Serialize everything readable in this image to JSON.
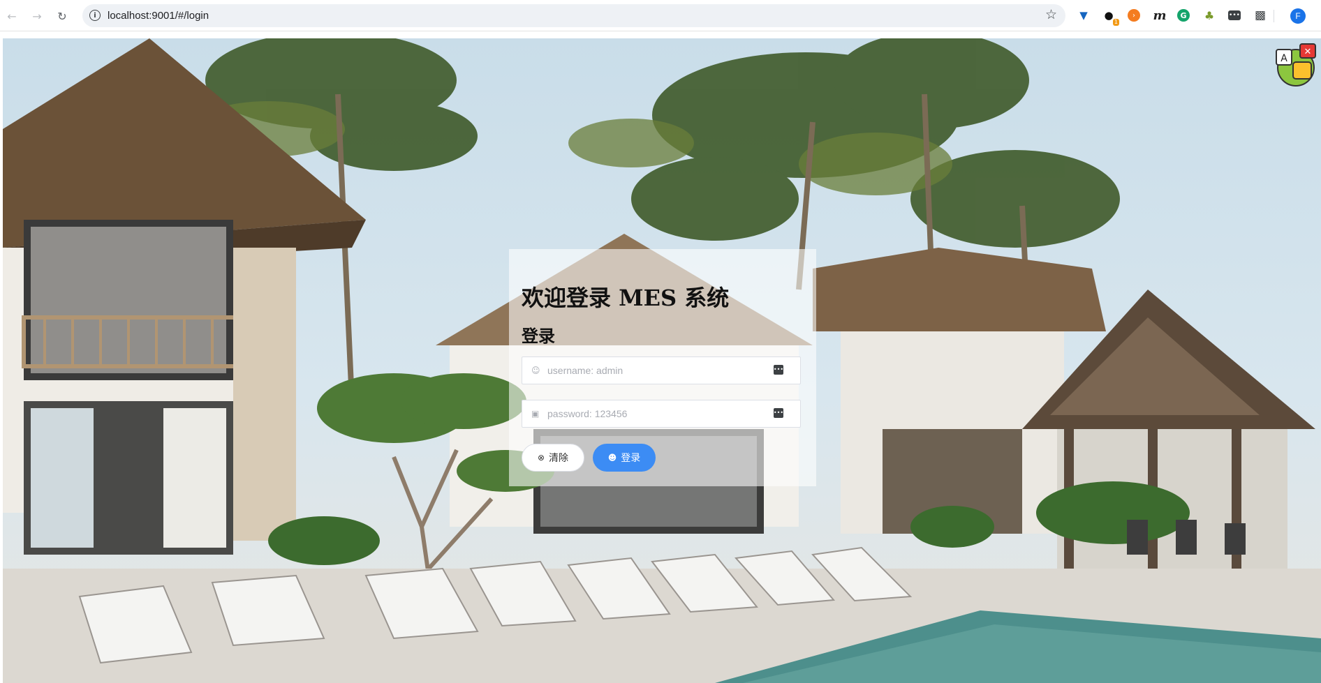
{
  "browser": {
    "url": "localhost:9001/#/login",
    "back_icon": "arrow-left-icon",
    "forward_icon": "arrow-right-icon",
    "reload_icon": "reload-icon",
    "info_icon": "info-icon",
    "bookmark_icon": "star-icon",
    "extensions": [
      "v-extension-icon",
      "c-extension-icon",
      "orange-extension-icon",
      "m-extension-icon",
      "grammarly-icon",
      "tree-extension-icon",
      "dots-extension-icon",
      "puzzle-icon"
    ],
    "ext_badge": "1",
    "profile_initial": "F"
  },
  "login": {
    "title": "欢迎登录 MES 系统",
    "subtitle": "登录",
    "username_placeholder": "username: admin",
    "password_placeholder": "password: 123456",
    "clear_label": "清除",
    "login_label": "登录"
  },
  "colors": {
    "primary": "#3c8cf4",
    "card_bg": "rgba(255,255,255,0.58)"
  }
}
